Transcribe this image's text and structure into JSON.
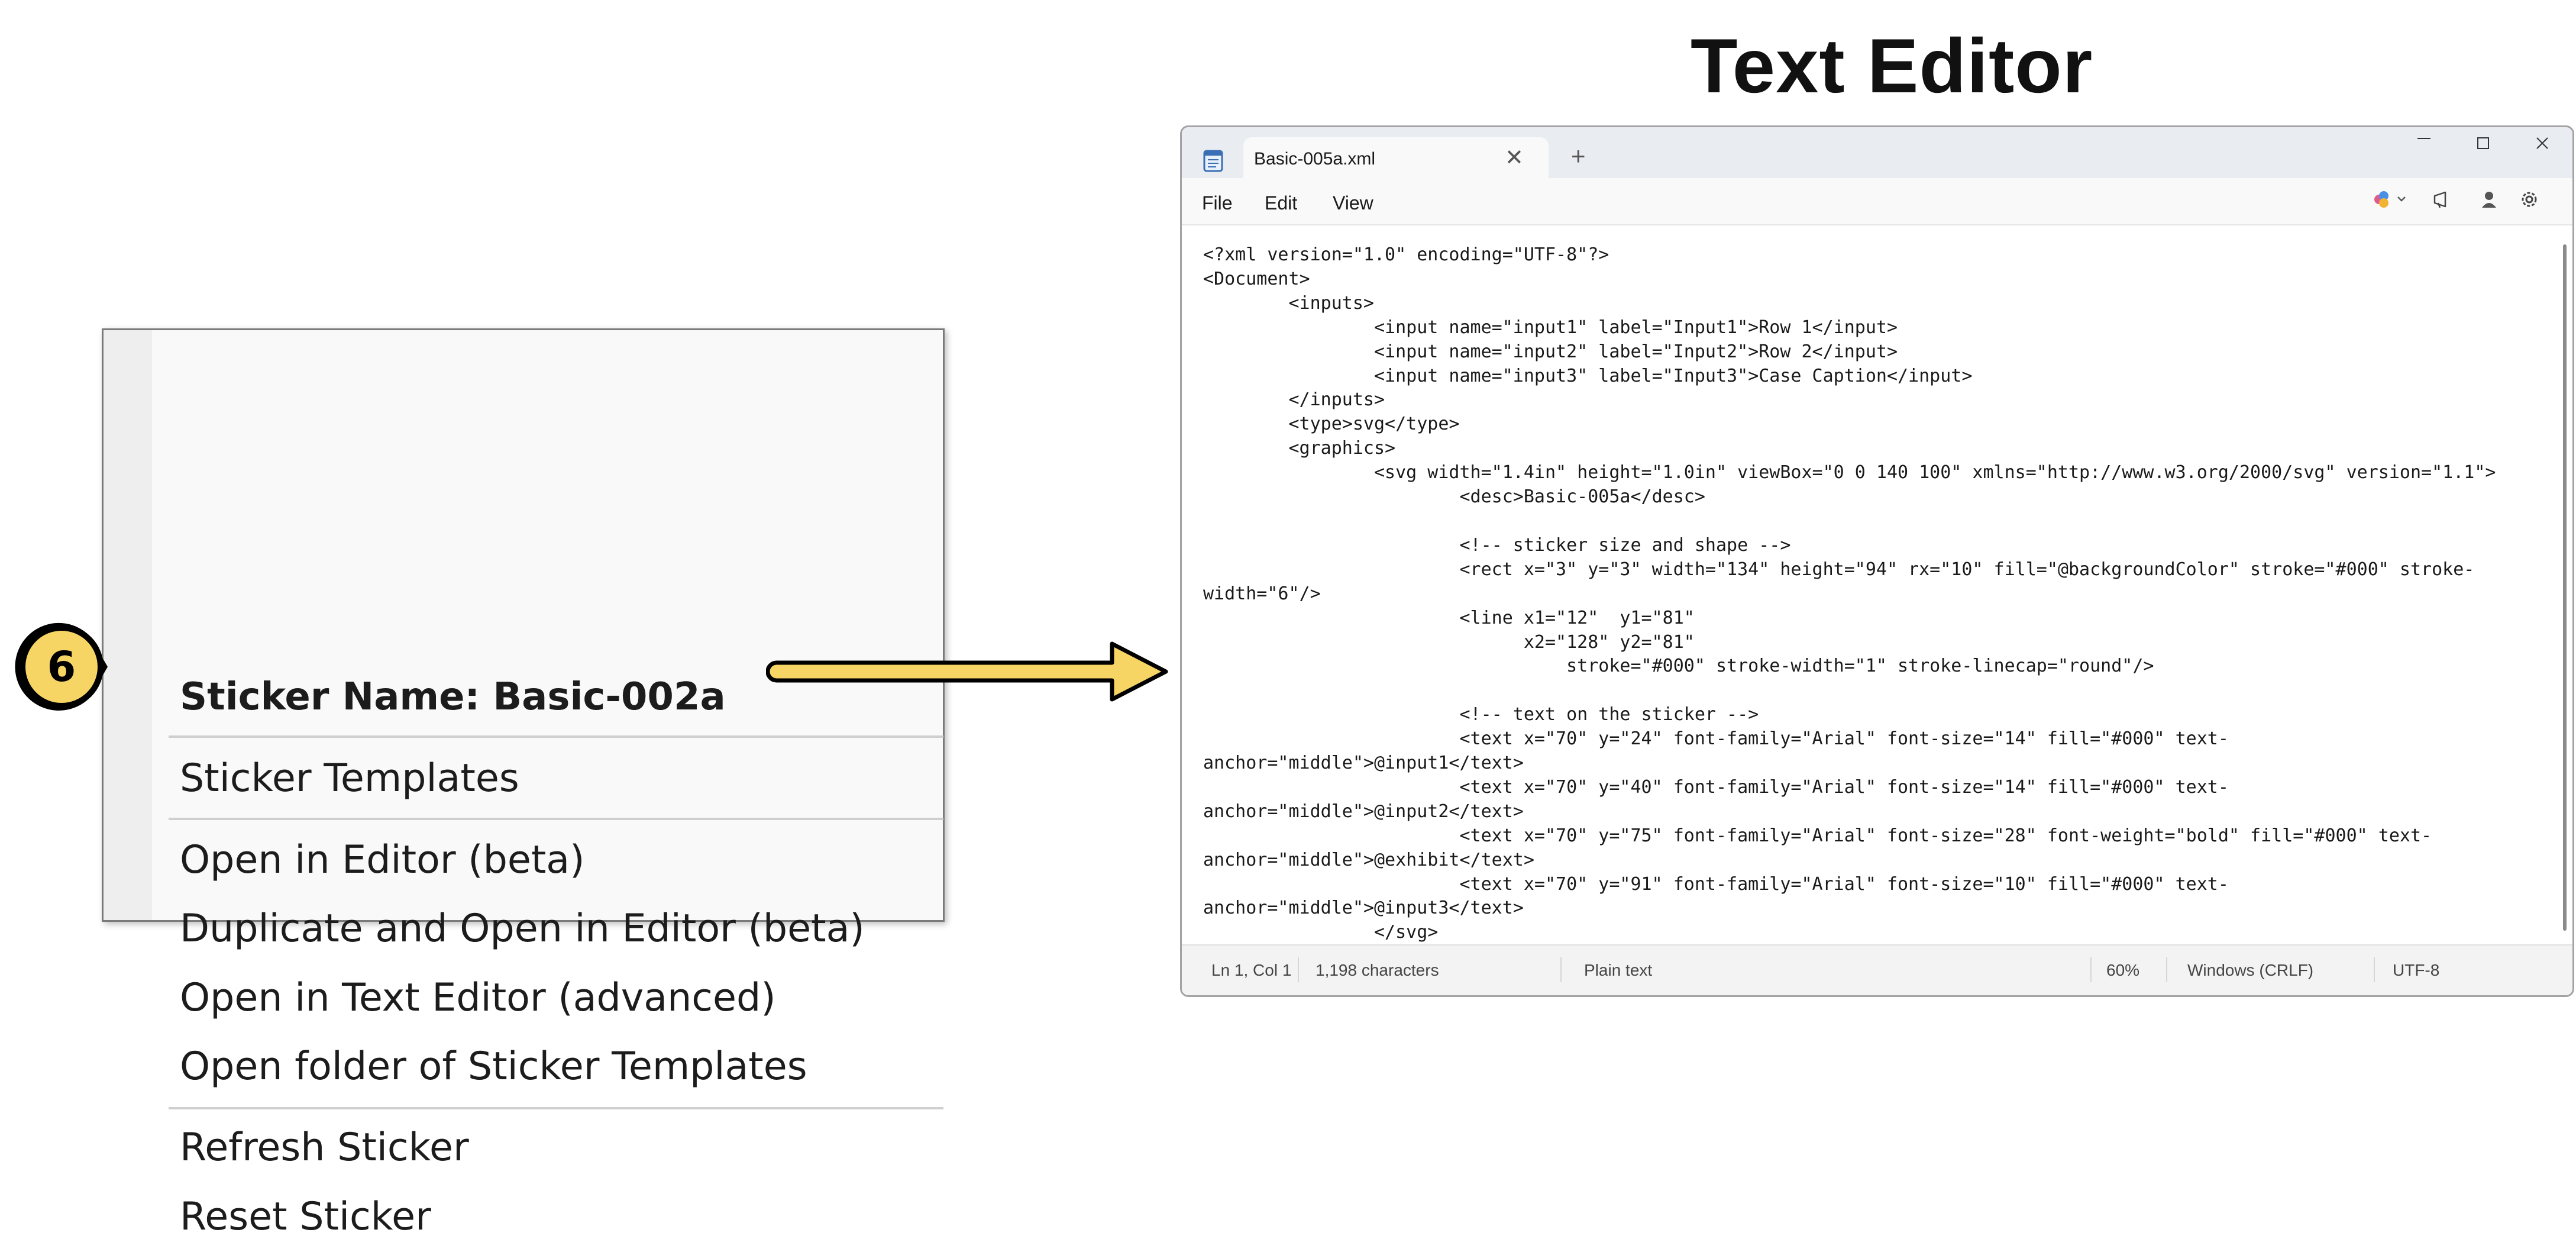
{
  "context_menu": {
    "header": "Sticker Name: Basic-002a",
    "items": [
      "Sticker Templates",
      "Open in Editor (beta)",
      "Duplicate and Open in Editor (beta)",
      "Open in Text Editor (advanced)",
      "Open folder of Sticker Templates",
      "Refresh Sticker",
      "Reset Sticker"
    ]
  },
  "callout": {
    "step_number": "6",
    "color": "#f7d565",
    "outline": "#000000"
  },
  "editor_heading": "Text Editor",
  "notepad": {
    "tab_title": "Basic-005a.xml",
    "new_tab_symbol": "+",
    "close_tab_symbol": "✕",
    "menu": [
      "File",
      "Edit",
      "View"
    ],
    "code": "<?xml version=\"1.0\" encoding=\"UTF-8\"?>\n<Document>\n        <inputs>\n                <input name=\"input1\" label=\"Input1\">Row 1</input>\n                <input name=\"input2\" label=\"Input2\">Row 2</input>\n                <input name=\"input3\" label=\"Input3\">Case Caption</input>\n        </inputs>\n        <type>svg</type>\n        <graphics>\n                <svg width=\"1.4in\" height=\"1.0in\" viewBox=\"0 0 140 100\" xmlns=\"http://www.w3.org/2000/svg\" version=\"1.1\">\n                        <desc>Basic-005a</desc>\n\n                        <!-- sticker size and shape -->\n                        <rect x=\"3\" y=\"3\" width=\"134\" height=\"94\" rx=\"10\" fill=\"@backgroundColor\" stroke=\"#000\" stroke-\nwidth=\"6\"/>\n                        <line x1=\"12\"  y1=\"81\"\n                              x2=\"128\" y2=\"81\"\n                                  stroke=\"#000\" stroke-width=\"1\" stroke-linecap=\"round\"/>\n\n                        <!-- text on the sticker -->\n                        <text x=\"70\" y=\"24\" font-family=\"Arial\" font-size=\"14\" fill=\"#000\" text-\nanchor=\"middle\">@input1</text>\n                        <text x=\"70\" y=\"40\" font-family=\"Arial\" font-size=\"14\" fill=\"#000\" text-\nanchor=\"middle\">@input2</text>\n                        <text x=\"70\" y=\"75\" font-family=\"Arial\" font-size=\"28\" font-weight=\"bold\" fill=\"#000\" text-\nanchor=\"middle\">@exhibit</text>\n                        <text x=\"70\" y=\"91\" font-family=\"Arial\" font-size=\"10\" fill=\"#000\" text-\nanchor=\"middle\">@input3</text>\n                </svg>\n        </graphics>",
    "status": {
      "position": "Ln 1, Col 1",
      "characters": "1,198 characters",
      "format": "Plain text",
      "zoom": "60%",
      "line_endings": "Windows (CRLF)",
      "encoding": "UTF-8"
    }
  }
}
